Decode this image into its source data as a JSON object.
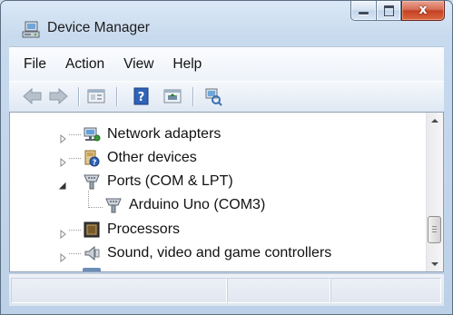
{
  "window": {
    "title": "Device Manager",
    "accent_close": "#c7432a"
  },
  "caption_buttons": {
    "minimize_icon": "minimize-icon",
    "maximize_icon": "maximize-icon",
    "close_glyph": "x"
  },
  "menu": {
    "items": [
      {
        "label": "File"
      },
      {
        "label": "Action"
      },
      {
        "label": "View"
      },
      {
        "label": "Help"
      }
    ]
  },
  "toolbar": {
    "buttons": [
      "back-arrow-icon",
      "forward-arrow-icon",
      "properties-icon",
      "help-icon",
      "update-driver-icon",
      "scan-hardware-icon"
    ]
  },
  "tree": {
    "items": [
      {
        "label": "Network adapters",
        "state": "collapsed",
        "icon": "network-adapter-icon"
      },
      {
        "label": "Other devices",
        "state": "collapsed",
        "icon": "unknown-device-icon"
      },
      {
        "label": "Ports (COM & LPT)",
        "state": "expanded",
        "icon": "port-icon"
      },
      {
        "label": "Arduino Uno (COM3)",
        "state": "leaf",
        "icon": "port-icon"
      },
      {
        "label": "Processors",
        "state": "collapsed",
        "icon": "processor-icon"
      },
      {
        "label": "Sound, video and game controllers",
        "state": "collapsed",
        "icon": "speaker-icon"
      }
    ]
  }
}
